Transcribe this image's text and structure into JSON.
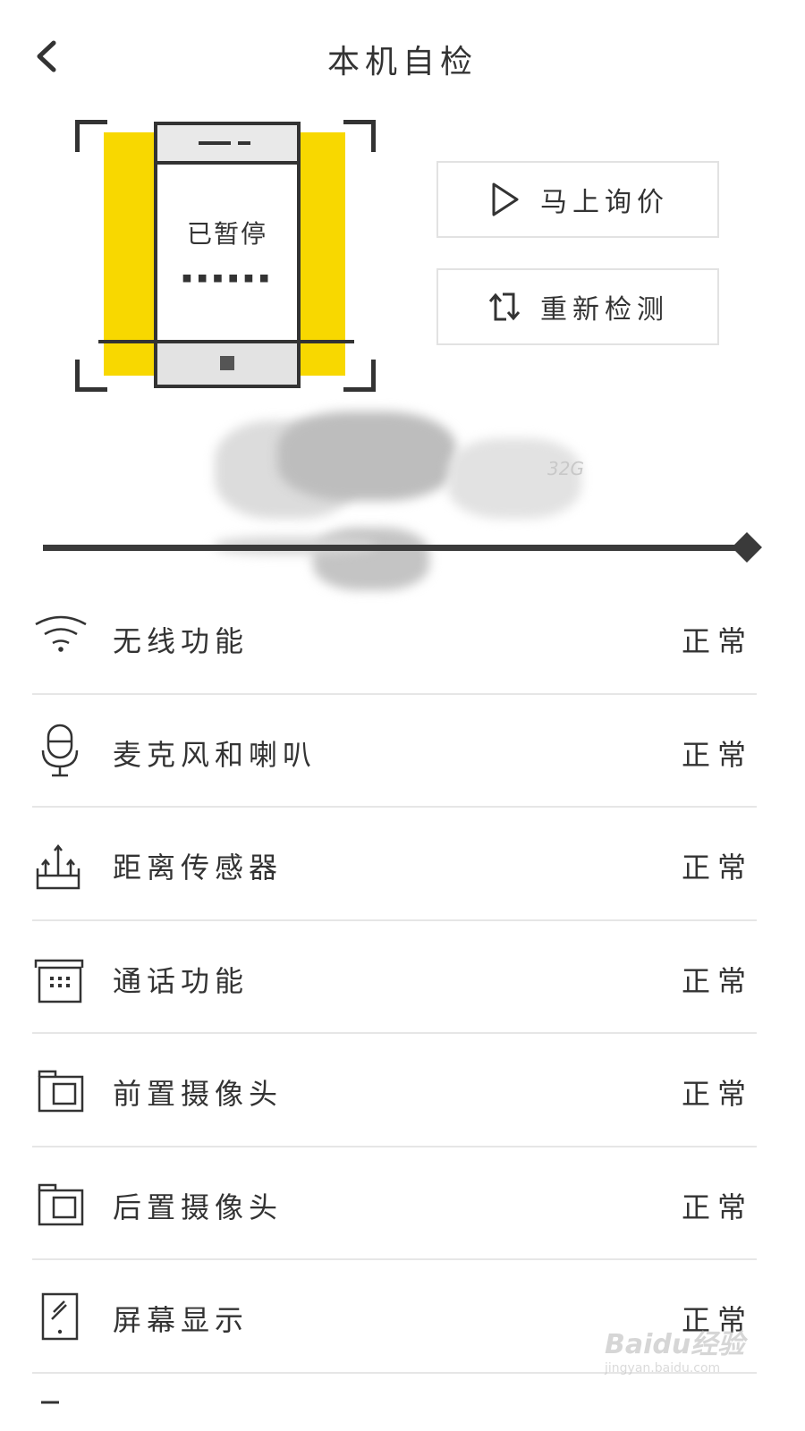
{
  "header": {
    "title": "本机自检",
    "back_icon": "chevron-left-icon"
  },
  "illustration": {
    "status_text": "已暂停",
    "masked_text": "▪▪▪▪▪▪",
    "accent_color": "#f8d800"
  },
  "actions": {
    "quote_label": "马上询价",
    "quote_icon": "play-icon",
    "retest_label": "重新检测",
    "retest_icon": "refresh-icon"
  },
  "device_info": {
    "storage": "32G"
  },
  "progress": {
    "value": 1.0
  },
  "checks": [
    {
      "name": "无线功能",
      "status": "正常",
      "icon": "wifi-icon"
    },
    {
      "name": "麦克风和喇叭",
      "status": "正常",
      "icon": "microphone-icon"
    },
    {
      "name": "距离传感器",
      "status": "正常",
      "icon": "proximity-sensor-icon"
    },
    {
      "name": "通话功能",
      "status": "正常",
      "icon": "telephone-icon"
    },
    {
      "name": "前置摄像头",
      "status": "正常",
      "icon": "front-camera-icon"
    },
    {
      "name": "后置摄像头",
      "status": "正常",
      "icon": "rear-camera-icon"
    },
    {
      "name": "屏幕显示",
      "status": "正常",
      "icon": "screen-icon"
    }
  ],
  "watermark": {
    "logo": "Baidu经验",
    "url": "jingyan.baidu.com"
  }
}
